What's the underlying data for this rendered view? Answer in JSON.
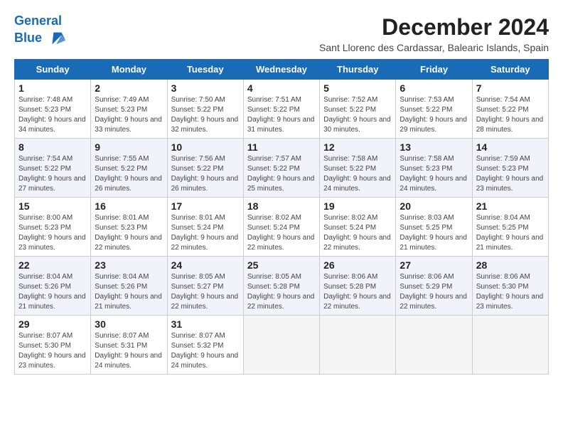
{
  "header": {
    "logo_line1": "General",
    "logo_line2": "Blue",
    "month_year": "December 2024",
    "location": "Sant Llorenc des Cardassar, Balearic Islands, Spain"
  },
  "weekdays": [
    "Sunday",
    "Monday",
    "Tuesday",
    "Wednesday",
    "Thursday",
    "Friday",
    "Saturday"
  ],
  "weeks": [
    [
      {
        "day": 1,
        "sunrise": "7:48 AM",
        "sunset": "5:23 PM",
        "daylight": "9 hours and 34 minutes."
      },
      {
        "day": 2,
        "sunrise": "7:49 AM",
        "sunset": "5:23 PM",
        "daylight": "9 hours and 33 minutes."
      },
      {
        "day": 3,
        "sunrise": "7:50 AM",
        "sunset": "5:22 PM",
        "daylight": "9 hours and 32 minutes."
      },
      {
        "day": 4,
        "sunrise": "7:51 AM",
        "sunset": "5:22 PM",
        "daylight": "9 hours and 31 minutes."
      },
      {
        "day": 5,
        "sunrise": "7:52 AM",
        "sunset": "5:22 PM",
        "daylight": "9 hours and 30 minutes."
      },
      {
        "day": 6,
        "sunrise": "7:53 AM",
        "sunset": "5:22 PM",
        "daylight": "9 hours and 29 minutes."
      },
      {
        "day": 7,
        "sunrise": "7:54 AM",
        "sunset": "5:22 PM",
        "daylight": "9 hours and 28 minutes."
      }
    ],
    [
      {
        "day": 8,
        "sunrise": "7:54 AM",
        "sunset": "5:22 PM",
        "daylight": "9 hours and 27 minutes."
      },
      {
        "day": 9,
        "sunrise": "7:55 AM",
        "sunset": "5:22 PM",
        "daylight": "9 hours and 26 minutes."
      },
      {
        "day": 10,
        "sunrise": "7:56 AM",
        "sunset": "5:22 PM",
        "daylight": "9 hours and 26 minutes."
      },
      {
        "day": 11,
        "sunrise": "7:57 AM",
        "sunset": "5:22 PM",
        "daylight": "9 hours and 25 minutes."
      },
      {
        "day": 12,
        "sunrise": "7:58 AM",
        "sunset": "5:22 PM",
        "daylight": "9 hours and 24 minutes."
      },
      {
        "day": 13,
        "sunrise": "7:58 AM",
        "sunset": "5:23 PM",
        "daylight": "9 hours and 24 minutes."
      },
      {
        "day": 14,
        "sunrise": "7:59 AM",
        "sunset": "5:23 PM",
        "daylight": "9 hours and 23 minutes."
      }
    ],
    [
      {
        "day": 15,
        "sunrise": "8:00 AM",
        "sunset": "5:23 PM",
        "daylight": "9 hours and 23 minutes."
      },
      {
        "day": 16,
        "sunrise": "8:01 AM",
        "sunset": "5:23 PM",
        "daylight": "9 hours and 22 minutes."
      },
      {
        "day": 17,
        "sunrise": "8:01 AM",
        "sunset": "5:24 PM",
        "daylight": "9 hours and 22 minutes."
      },
      {
        "day": 18,
        "sunrise": "8:02 AM",
        "sunset": "5:24 PM",
        "daylight": "9 hours and 22 minutes."
      },
      {
        "day": 19,
        "sunrise": "8:02 AM",
        "sunset": "5:24 PM",
        "daylight": "9 hours and 22 minutes."
      },
      {
        "day": 20,
        "sunrise": "8:03 AM",
        "sunset": "5:25 PM",
        "daylight": "9 hours and 21 minutes."
      },
      {
        "day": 21,
        "sunrise": "8:04 AM",
        "sunset": "5:25 PM",
        "daylight": "9 hours and 21 minutes."
      }
    ],
    [
      {
        "day": 22,
        "sunrise": "8:04 AM",
        "sunset": "5:26 PM",
        "daylight": "9 hours and 21 minutes."
      },
      {
        "day": 23,
        "sunrise": "8:04 AM",
        "sunset": "5:26 PM",
        "daylight": "9 hours and 21 minutes."
      },
      {
        "day": 24,
        "sunrise": "8:05 AM",
        "sunset": "5:27 PM",
        "daylight": "9 hours and 22 minutes."
      },
      {
        "day": 25,
        "sunrise": "8:05 AM",
        "sunset": "5:28 PM",
        "daylight": "9 hours and 22 minutes."
      },
      {
        "day": 26,
        "sunrise": "8:06 AM",
        "sunset": "5:28 PM",
        "daylight": "9 hours and 22 minutes."
      },
      {
        "day": 27,
        "sunrise": "8:06 AM",
        "sunset": "5:29 PM",
        "daylight": "9 hours and 22 minutes."
      },
      {
        "day": 28,
        "sunrise": "8:06 AM",
        "sunset": "5:30 PM",
        "daylight": "9 hours and 23 minutes."
      }
    ],
    [
      {
        "day": 29,
        "sunrise": "8:07 AM",
        "sunset": "5:30 PM",
        "daylight": "9 hours and 23 minutes."
      },
      {
        "day": 30,
        "sunrise": "8:07 AM",
        "sunset": "5:31 PM",
        "daylight": "9 hours and 24 minutes."
      },
      {
        "day": 31,
        "sunrise": "8:07 AM",
        "sunset": "5:32 PM",
        "daylight": "9 hours and 24 minutes."
      },
      null,
      null,
      null,
      null
    ]
  ]
}
